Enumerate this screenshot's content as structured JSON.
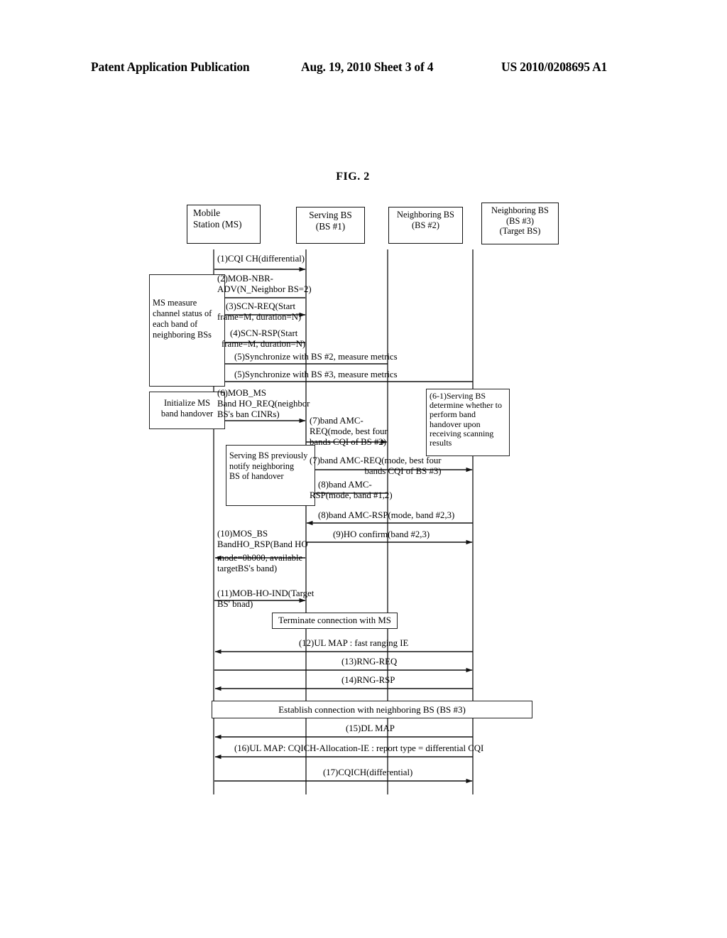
{
  "page_header": {
    "left": "Patent Application Publication",
    "middle": "Aug. 19, 2010  Sheet 3 of 4",
    "right": "US 2010/0208695 A1"
  },
  "figure": {
    "title": "FIG. 2",
    "type": "sequence-diagram",
    "actors": [
      {
        "id": "ms",
        "lines": [
          "Mobile",
          "Station (MS)"
        ]
      },
      {
        "id": "bs1",
        "lines": [
          "Serving BS",
          "(BS #1)"
        ]
      },
      {
        "id": "bs2",
        "lines": [
          "Neighboring BS",
          "(BS #2)"
        ]
      },
      {
        "id": "bs3",
        "lines": [
          "Neighboring BS",
          "(BS #3)",
          "(Target BS)"
        ]
      }
    ],
    "notes": [
      {
        "id": "note-ms-measure",
        "lines": [
          "MS measure",
          "channel status of",
          "each band of",
          "neighboring BSs"
        ]
      },
      {
        "id": "note-init-ho",
        "lines": [
          "Initialize MS",
          "band handover"
        ]
      },
      {
        "id": "note-6-1",
        "lines": [
          "(6-1)Serving BS",
          "determine whether to",
          "perform band",
          "handover upon",
          "receiving scanning",
          "results"
        ]
      },
      {
        "id": "note-prev-notify",
        "lines": [
          "Serving BS previously",
          "notify neighboring",
          "BS of handover"
        ]
      },
      {
        "id": "note-terminate",
        "lines": [
          "Terminate connection with MS"
        ]
      },
      {
        "id": "note-establish",
        "lines": [
          "Establish connection with neighboring BS (BS #3)"
        ]
      }
    ],
    "messages": [
      {
        "num": "(1)",
        "lines": [
          "(1)CQI CH(differential)"
        ],
        "from": "ms",
        "to": "bs1"
      },
      {
        "num": "(2)",
        "lines": [
          "(2)MOB-NBR-",
          "ADV(N_Neighbor BS=2)"
        ],
        "from": "bs1",
        "to": "ms"
      },
      {
        "num": "(3)",
        "lines": [
          "(3)SCN-REQ(Start",
          "frame=M, duration=N)"
        ],
        "from": "ms",
        "to": "bs1"
      },
      {
        "num": "(4)",
        "lines": [
          "(4)SCN-RSP(Start",
          "frame=M, duration=N)"
        ],
        "from": "bs1",
        "to": "ms"
      },
      {
        "num": "(5a)",
        "lines": [
          "(5)Synchronize with BS #2, measure metrics"
        ],
        "from": "bs2",
        "to": "ms"
      },
      {
        "num": "(5b)",
        "lines": [
          "(5)Synchronize with BS #3, measure metrics"
        ],
        "from": "bs3",
        "to": "ms"
      },
      {
        "num": "(6)",
        "lines": [
          "(6)MOB_MS",
          "Band HO_REQ(neighbor",
          "BS's ban CINRs)"
        ],
        "from": "ms",
        "to": "bs1"
      },
      {
        "num": "(7a)",
        "lines": [
          "(7)band AMC-",
          "REQ(mode, best four",
          "bands CQI of BS #2)"
        ],
        "from": "bs1",
        "to": "bs2"
      },
      {
        "num": "(7b)",
        "lines": [
          "(7)band AMC-REQ(mode, best four",
          "bands CQI of BS #3)"
        ],
        "from": "bs1",
        "to": "bs3"
      },
      {
        "num": "(8a)",
        "lines": [
          "(8)band AMC-",
          "RSP(mode, band #1,2)"
        ],
        "from": "bs2",
        "to": "bs1"
      },
      {
        "num": "(8b)",
        "lines": [
          "(8)band AMC-RSP(mode, band #2,3)"
        ],
        "from": "bs3",
        "to": "bs1"
      },
      {
        "num": "(9)",
        "lines": [
          "(9)HO confirm(band #2,3)"
        ],
        "from": "bs1",
        "to": "bs3"
      },
      {
        "num": "(10)",
        "lines": [
          "(10)MOS_BS",
          "BandHO_RSP(Band HO",
          "mode=0b000, available",
          "targetBS's band)"
        ],
        "from": "bs1",
        "to": "ms"
      },
      {
        "num": "(11)",
        "lines": [
          "(11)MOB-HO-IND(Target",
          "BS' bnad)"
        ],
        "from": "ms",
        "to": "bs1"
      },
      {
        "num": "(12)",
        "lines": [
          "(12)UL MAP : fast ranging IE"
        ],
        "from": "bs3",
        "to": "ms"
      },
      {
        "num": "(13)",
        "lines": [
          "(13)RNG-REQ"
        ],
        "from": "ms",
        "to": "bs3"
      },
      {
        "num": "(14)",
        "lines": [
          "(14)RNG-RSP"
        ],
        "from": "bs3",
        "to": "ms"
      },
      {
        "num": "(15)",
        "lines": [
          "(15)DL MAP"
        ],
        "from": "bs3",
        "to": "ms"
      },
      {
        "num": "(16)",
        "lines": [
          "(16)UL MAP: CQICH-Allocation-IE : report type = differential CQI"
        ],
        "from": "bs3",
        "to": "ms"
      },
      {
        "num": "(17)",
        "lines": [
          "(17)CQICH(differential)"
        ],
        "from": "ms",
        "to": "bs3"
      }
    ]
  }
}
